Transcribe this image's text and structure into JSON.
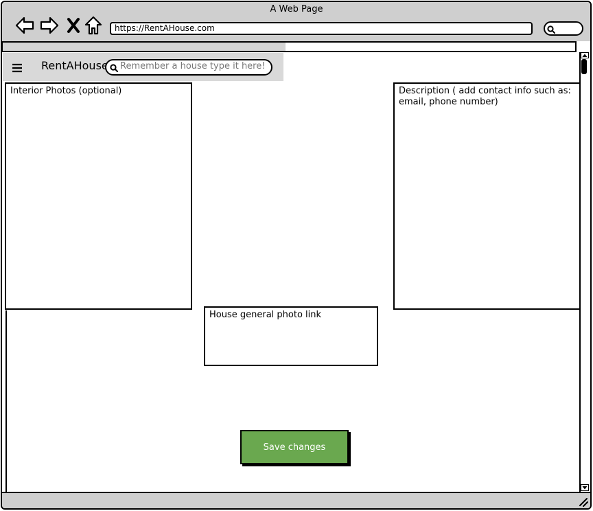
{
  "browser": {
    "title": "A Web Page",
    "url": "https://RentAHouse.com"
  },
  "app": {
    "brand": "RentAHouse",
    "search": {
      "placeholder": "Remember a house type it here!"
    }
  },
  "form": {
    "interior_photos_label": "Interior Photos (optional)",
    "description_label": "Description ( add contact info such as: email, phone number)",
    "general_photo_label": "House general photo link",
    "save_label": "Save changes"
  },
  "icons": {
    "back": "arrow-left-icon",
    "forward": "arrow-right-icon",
    "stop": "close-icon",
    "home": "home-icon",
    "search": "search-icon",
    "menu": "hamburger-menu-icon",
    "resize": "resize-grip-icon"
  },
  "colors": {
    "chrome": "#cfcfcf",
    "appbar": "#d9d9d9",
    "save_button": "#6aa84f"
  }
}
